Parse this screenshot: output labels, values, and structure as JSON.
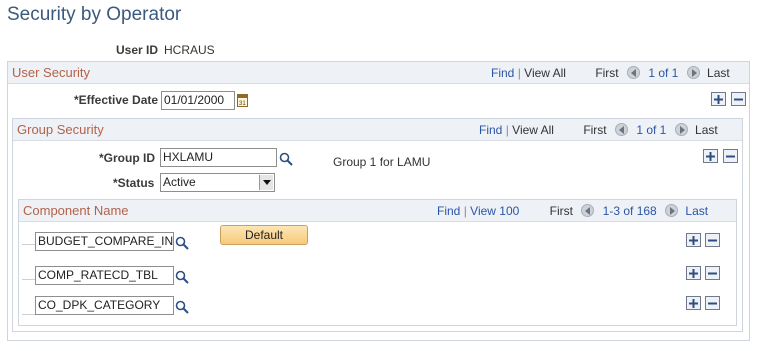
{
  "page": {
    "title": "Security by Operator"
  },
  "user": {
    "label": "User ID",
    "value": "HCRAUS"
  },
  "user_security": {
    "title": "User Security",
    "nav": {
      "find": "Find",
      "sep": "|",
      "view_all": "View All",
      "first": "First",
      "count": "1 of 1",
      "last": "Last"
    },
    "effective_date": {
      "label": "*Effective Date",
      "value": "01/01/2000"
    }
  },
  "group_security": {
    "title": "Group Security",
    "nav": {
      "find": "Find",
      "sep": "|",
      "view_all": "View All",
      "first": "First",
      "count": "1 of 1",
      "last": "Last"
    },
    "group_id": {
      "label": "*Group ID",
      "value": "HXLAMU",
      "description": "Group 1 for LAMU"
    },
    "status": {
      "label": "*Status",
      "value": "Active"
    }
  },
  "components": {
    "title": "Component Name",
    "nav": {
      "find": "Find",
      "sep": "|",
      "view": "View 100",
      "first": "First",
      "count": "1-3 of 168",
      "last": "Last"
    },
    "default_button": "Default",
    "rows": [
      {
        "value": "BUDGET_COMPARE_INQ"
      },
      {
        "value": "COMP_RATECD_TBL"
      },
      {
        "value": "CO_DPK_CATEGORY"
      }
    ]
  }
}
